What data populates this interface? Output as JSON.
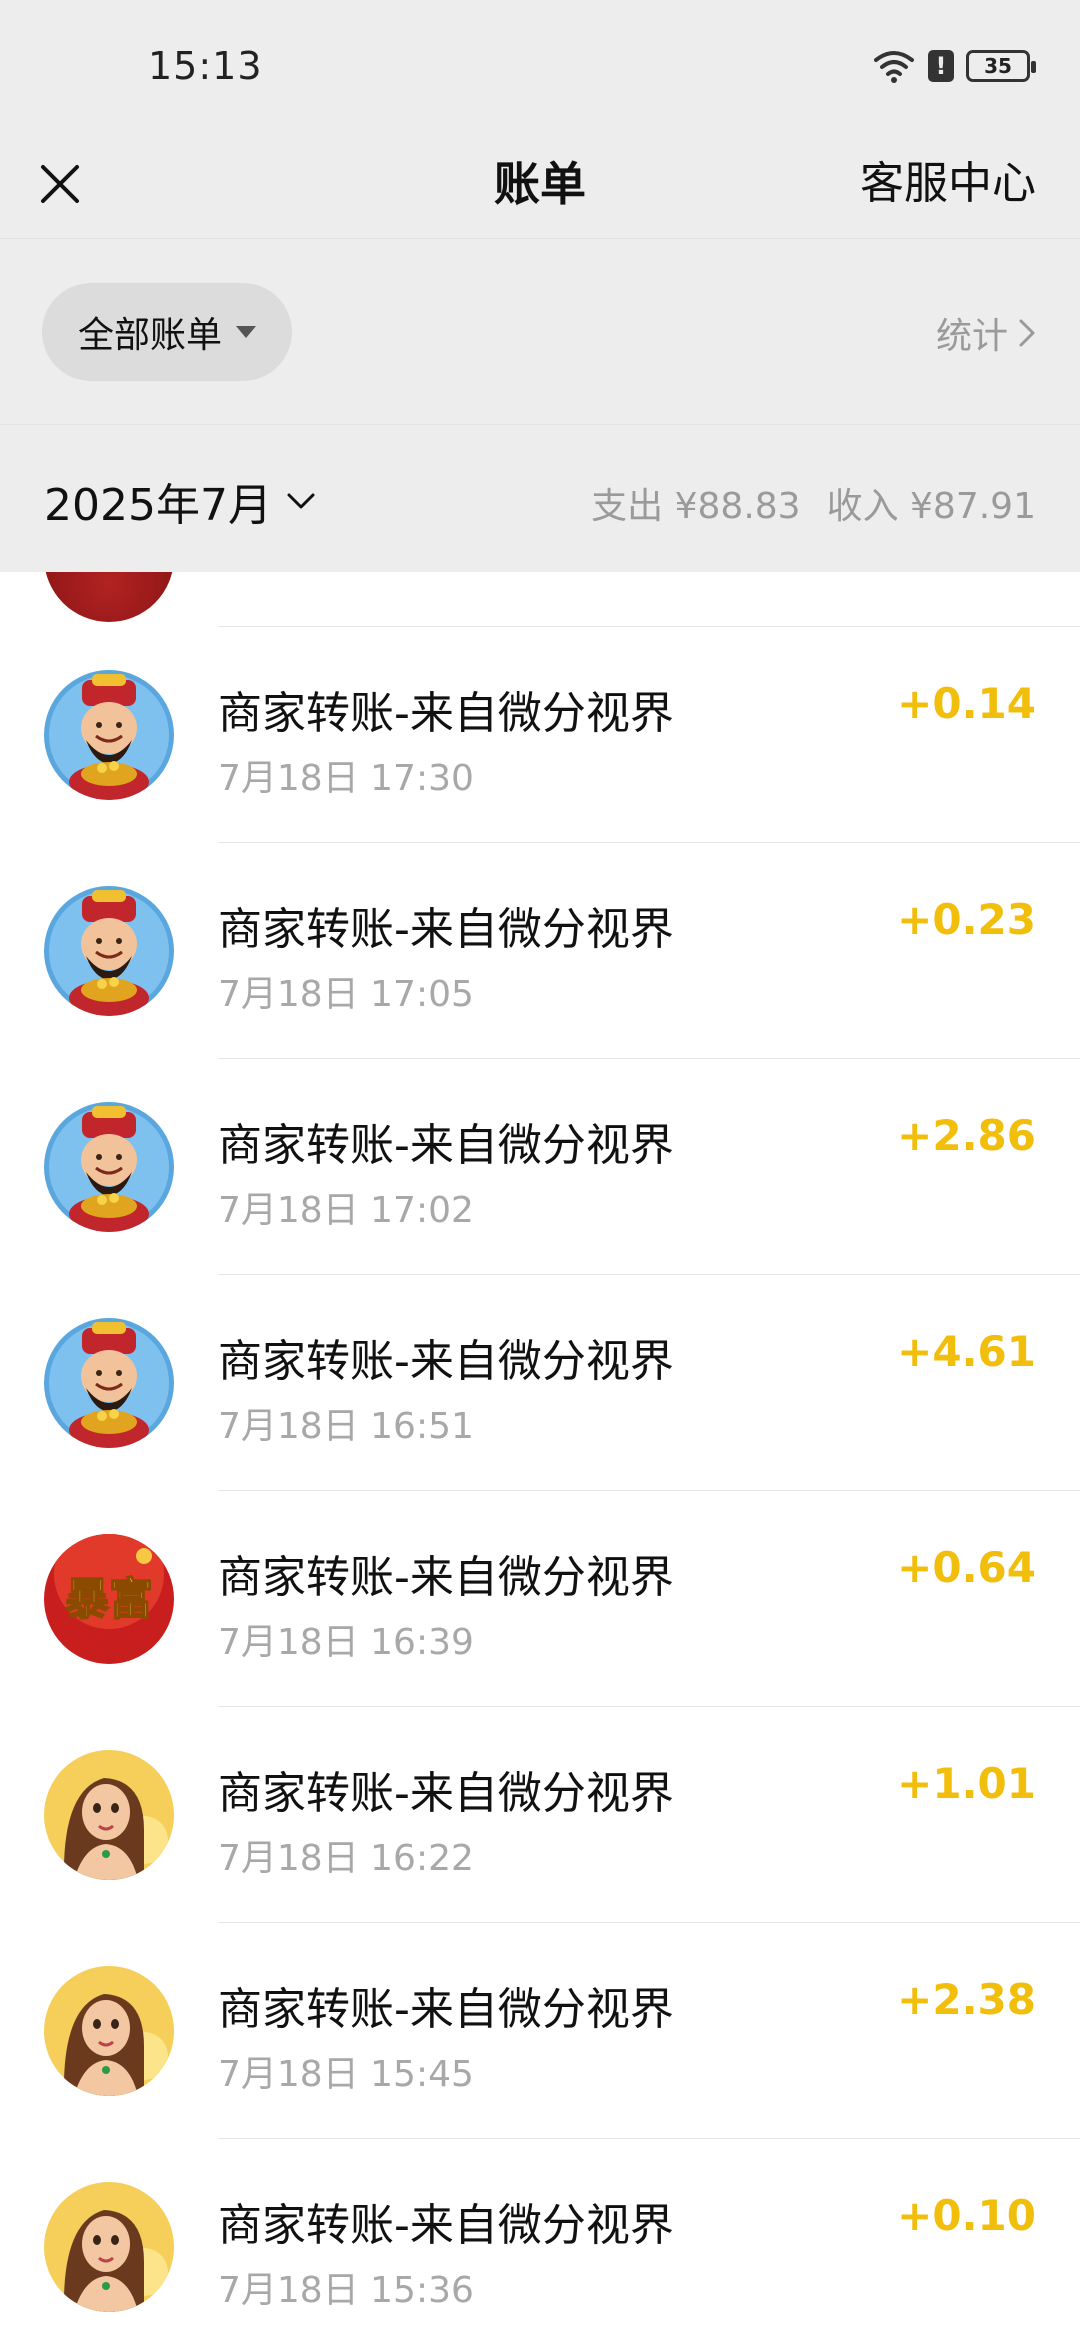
{
  "status_bar": {
    "time": "15:13",
    "battery": "35",
    "alert_icon": "!"
  },
  "nav": {
    "title": "账单",
    "right_label": "客服中心"
  },
  "filter": {
    "pill_label": "全部账单",
    "stats_label": "统计"
  },
  "month": {
    "label": "2025年7月",
    "expense": "支出 ¥88.83",
    "income": "收入 ¥87.91"
  },
  "colors": {
    "amount": "#f2be0c",
    "background": "#ededed"
  },
  "transactions": [
    {
      "title": "商家转账-来自微分视界",
      "time": "7月18日 17:30",
      "amount": "+0.14",
      "avatar": "god-of-wealth"
    },
    {
      "title": "商家转账-来自微分视界",
      "time": "7月18日 17:05",
      "amount": "+0.23",
      "avatar": "god-of-wealth"
    },
    {
      "title": "商家转账-来自微分视界",
      "time": "7月18日 17:02",
      "amount": "+2.86",
      "avatar": "god-of-wealth"
    },
    {
      "title": "商家转账-来自微分视界",
      "time": "7月18日 16:51",
      "amount": "+4.61",
      "avatar": "god-of-wealth"
    },
    {
      "title": "商家转账-来自微分视界",
      "time": "7月18日 16:39",
      "amount": "+0.64",
      "avatar": "baofu",
      "avatar_text": "暴富"
    },
    {
      "title": "商家转账-来自微分视界",
      "time": "7月18日 16:22",
      "amount": "+1.01",
      "avatar": "woman"
    },
    {
      "title": "商家转账-来自微分视界",
      "time": "7月18日 15:45",
      "amount": "+2.38",
      "avatar": "woman"
    },
    {
      "title": "商家转账-来自微分视界",
      "time": "7月18日 15:36",
      "amount": "+0.10",
      "avatar": "woman"
    }
  ]
}
